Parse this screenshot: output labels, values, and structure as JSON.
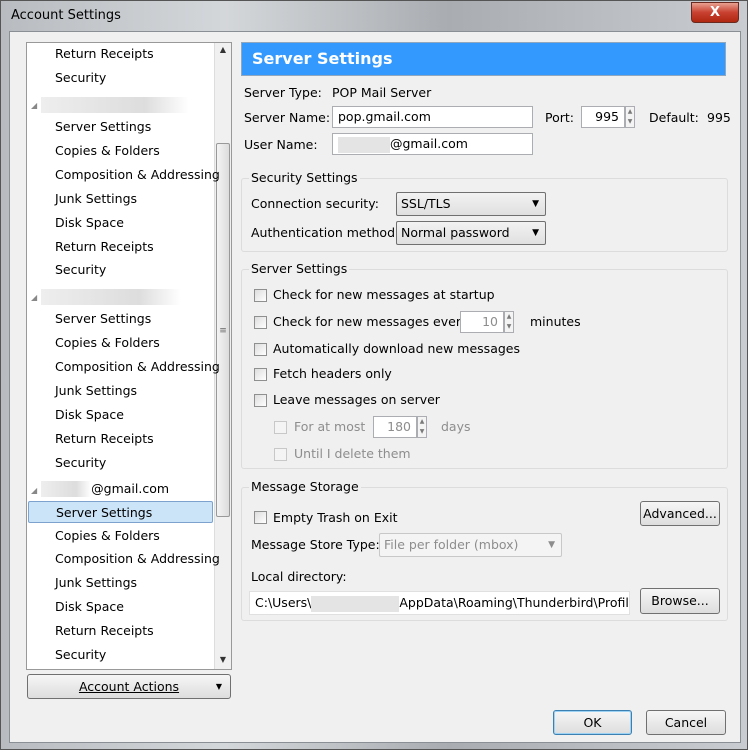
{
  "window": {
    "title": "Account Settings",
    "close": "X"
  },
  "tree": {
    "top_items": [
      "Return Receipts",
      "Security"
    ],
    "accounts": [
      {
        "name": "",
        "items": [
          "Server Settings",
          "Copies & Folders",
          "Composition & Addressing",
          "Junk Settings",
          "Disk Space",
          "Return Receipts",
          "Security"
        ]
      },
      {
        "name": "",
        "items": [
          "Server Settings",
          "Copies & Folders",
          "Composition & Addressing",
          "Junk Settings",
          "Disk Space",
          "Return Receipts",
          "Security"
        ]
      },
      {
        "name": "@gmail.com",
        "items": [
          "Server Settings",
          "Copies & Folders",
          "Composition & Addressing",
          "Junk Settings",
          "Disk Space",
          "Return Receipts",
          "Security"
        ],
        "selected": "Server Settings"
      }
    ]
  },
  "account_actions": "Account Actions",
  "panel": {
    "title": "Server Settings",
    "server_type_label": "Server Type:",
    "server_type": "POP Mail Server",
    "server_name_label": "Server Name:",
    "server_name": "pop.gmail.com",
    "port_label": "Port:",
    "port": "995",
    "default_label": "Default:",
    "default": "995",
    "user_name_label": "User Name:",
    "user_name": "@gmail.com"
  },
  "security": {
    "legend": "Security Settings",
    "conn_label": "Connection security:",
    "conn_value": "SSL/TLS",
    "auth_label": "Authentication method:",
    "auth_value": "Normal password"
  },
  "server": {
    "legend": "Server Settings",
    "check_startup": "Check for new messages at startup",
    "check_every": "Check for new messages every",
    "minutes_value": "10",
    "minutes": "minutes",
    "auto_download": "Automatically download new messages",
    "fetch_headers": "Fetch headers only",
    "leave_on_server": "Leave messages on server",
    "for_at_most": "For at most",
    "days_value": "180",
    "days": "days",
    "until_delete": "Until I delete them"
  },
  "storage": {
    "legend": "Message Storage",
    "empty_trash": "Empty Trash on Exit",
    "advanced": "Advanced...",
    "store_type_label": "Message Store Type:",
    "store_type": "File per folder (mbox)",
    "local_dir_label": "Local directory:",
    "dir_start": "C:\\Users\\",
    "dir_end": "AppData\\Roaming\\Thunderbird\\Profiles",
    "browse": "Browse..."
  },
  "buttons": {
    "ok": "OK",
    "cancel": "Cancel"
  },
  "colors": {
    "header": "#3399ff",
    "selection": "#cce4f7"
  }
}
